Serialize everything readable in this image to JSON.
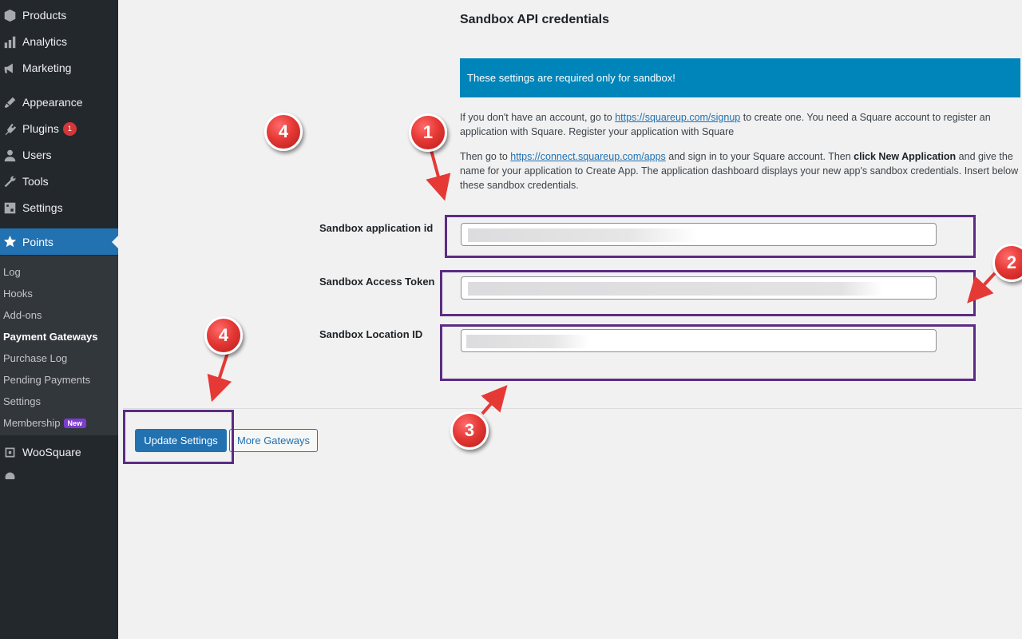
{
  "sidebar": {
    "top_items": [
      {
        "label": "Products",
        "icon": "products-icon"
      },
      {
        "label": "Analytics",
        "icon": "analytics-icon"
      },
      {
        "label": "Marketing",
        "icon": "marketing-icon"
      },
      {
        "label": "Appearance",
        "icon": "appearance-icon"
      },
      {
        "label": "Plugins",
        "icon": "plugins-icon",
        "badge": "1"
      },
      {
        "label": "Users",
        "icon": "users-icon"
      },
      {
        "label": "Tools",
        "icon": "tools-icon"
      },
      {
        "label": "Settings",
        "icon": "settings-icon"
      }
    ],
    "active_item": {
      "label": "Points",
      "icon": "star-icon"
    },
    "submenu": [
      {
        "label": "Log"
      },
      {
        "label": "Hooks"
      },
      {
        "label": "Add-ons"
      },
      {
        "label": "Payment Gateways",
        "current": true
      },
      {
        "label": "Purchase Log"
      },
      {
        "label": "Pending Payments"
      },
      {
        "label": "Settings"
      },
      {
        "label": "Membership",
        "badge": "New"
      }
    ],
    "after_items": [
      {
        "label": "WooSquare",
        "icon": "woosquare-icon"
      }
    ]
  },
  "main": {
    "heading": "Sandbox API credentials",
    "notice": "These settings are required only for sandbox!",
    "para1": {
      "text_before": "If you don't have an account, go to ",
      "link": "https://squareup.com/signup",
      "text_after": " to create one. You need a Square account to register an application with Square. Register your application with Square"
    },
    "para2": {
      "text_before": "Then go to ",
      "link": "https://connect.squareup.com/apps",
      "text_mid": " and sign in to your Square account. Then ",
      "bold": "click New Application",
      "text_after": " and give the name for your application to Create App. The application dashboard displays your new app's sandbox credentials. Insert below these sandbox credentials."
    },
    "fields": [
      {
        "label": "Sandbox application id"
      },
      {
        "label": "Sandbox Access Token"
      },
      {
        "label": "Sandbox Location ID"
      }
    ],
    "buttons": {
      "update": "Update Settings",
      "more": "More Gateways"
    }
  },
  "annotations": {
    "markers": [
      "1",
      "2",
      "3",
      "4",
      "4"
    ],
    "color_box": "#5b2c83",
    "color_marker": "#e53935"
  },
  "colors": {
    "sidebar_bg": "#23282d",
    "active_bg": "#2271b1",
    "notice_bg": "#0085ba",
    "page_bg": "#f1f1f1"
  }
}
